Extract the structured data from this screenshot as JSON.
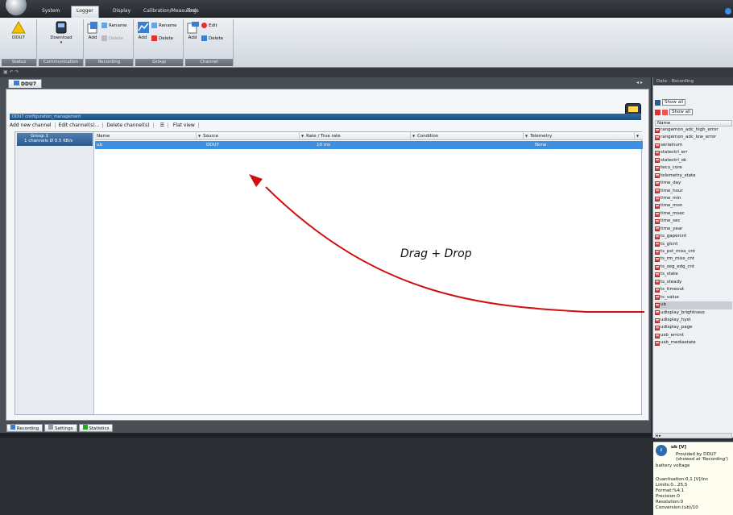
{
  "menu": [
    "System",
    "Logger",
    "Display",
    "Calibration/Measuring",
    "Tools"
  ],
  "ribbon": {
    "status": {
      "btn": "DDU7",
      "label": "Status"
    },
    "communication": {
      "btn": "Download",
      "label": "Communication"
    },
    "recording": {
      "add": "Add",
      "rename": "Rename",
      "delete": "Delete",
      "label": "Recording"
    },
    "group": {
      "add": "Add",
      "rename": "Rename",
      "delete": "Delete",
      "label": "Group"
    },
    "channel": {
      "add": "Add",
      "edit": "Edit",
      "delete": "Delete",
      "label": "Channel"
    }
  },
  "doc_tab": "DDU7",
  "panel_title": "DDU7 configuration_management",
  "toolbar": [
    "Add new channel",
    "Edit channel(s)...",
    "Delete channel(s)",
    "Flat view"
  ],
  "group": {
    "name": "Group 1",
    "info": "1 channels  Ø 0.5 KB/s"
  },
  "columns": [
    "Name",
    "Source",
    "Rate / True rate",
    "Condition",
    "Telemetry"
  ],
  "row": {
    "name": "ub",
    "source": "DDU7",
    "rate": "10 ms",
    "condition": "",
    "telemetry": "None"
  },
  "annotation": "Drag + Drop",
  "bottom_tabs": [
    "Recording",
    "Settings",
    "Statistics"
  ],
  "right_panel": {
    "title": "Data - Recording",
    "show_all": "Show all",
    "name_header": "Name",
    "variables": [
      "rangemon_adc_high_error",
      "rangemon_adc_low_error",
      "serialnum",
      "statectrl_err",
      "statectrl_ok",
      "tecu_core",
      "telemetry_state",
      "time_day",
      "time_hour",
      "time_min",
      "time_mon",
      "time_msec",
      "time_sec",
      "time_year",
      "ts_gapercnt",
      "ts_glcnt",
      "ts_pst_miss_cnt",
      "ts_rm_miss_cnt",
      "ts_seg_edg_cnt",
      "ts_state",
      "ts_steady",
      "ts_timeout",
      "ts_value",
      "ub",
      "udisplay_brightness",
      "udisplay_hyst",
      "udisplay_page",
      "usb_errcnt",
      "usb_mediastate"
    ],
    "selected": "ub",
    "info": {
      "title": "ub [V]",
      "provided": "Provided by DDU7",
      "showed": "(showed at 'Recording')",
      "desc": "battery voltage",
      "quant": "Quantisation:0,1 [V]/inc",
      "limits": "Limits:0...25,5",
      "format": "Format:%4.1",
      "precision": "Precision:0",
      "resolution": "Resolution:0",
      "conversion": "Conversion:(ub)/10"
    }
  }
}
